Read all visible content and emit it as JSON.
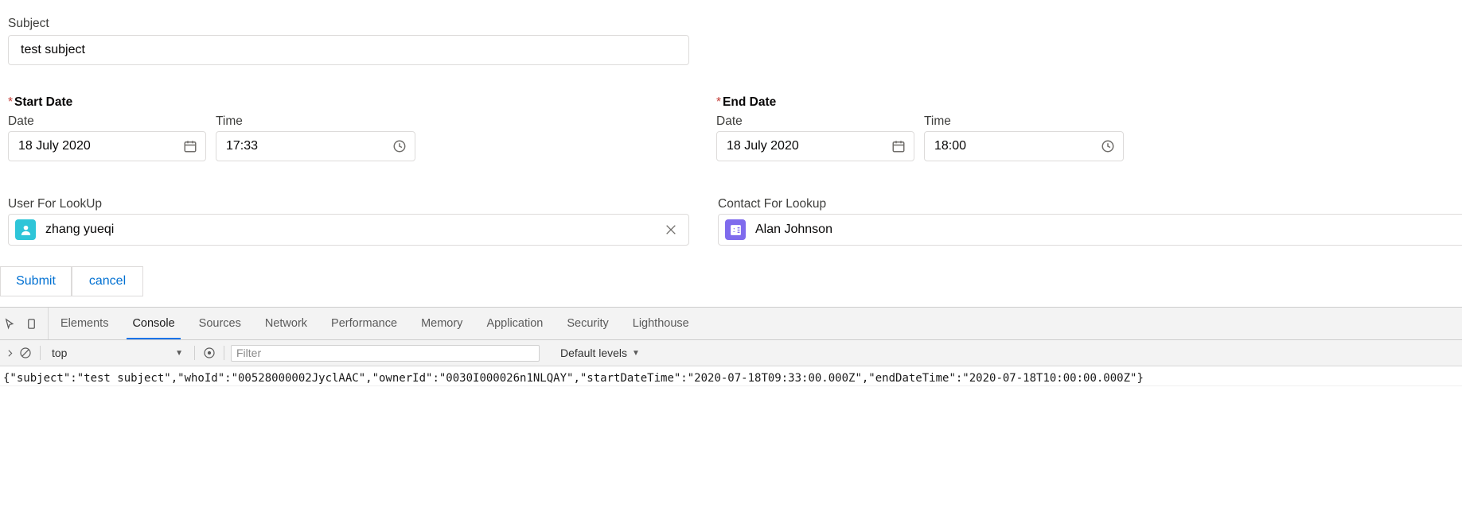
{
  "form": {
    "subject": {
      "label": "Subject",
      "value": "test subject"
    },
    "start": {
      "group_label": "Start Date",
      "required_marker": "*",
      "date_label": "Date",
      "date_value": "18 July 2020",
      "time_label": "Time",
      "time_value": "17:33"
    },
    "end": {
      "group_label": "End Date",
      "required_marker": "*",
      "date_label": "Date",
      "date_value": "18 July 2020",
      "time_label": "Time",
      "time_value": "18:00"
    },
    "user_lookup": {
      "label": "User For LookUp",
      "value": "zhang yueqi",
      "avatar_color": "#2ec5d8"
    },
    "contact_lookup": {
      "label": "Contact For Lookup",
      "value": "Alan Johnson",
      "avatar_color": "#7f6bed"
    },
    "buttons": {
      "submit": "Submit",
      "cancel": "cancel"
    }
  },
  "devtools": {
    "tabs": [
      {
        "label": "Elements",
        "active": false
      },
      {
        "label": "Console",
        "active": true
      },
      {
        "label": "Sources",
        "active": false
      },
      {
        "label": "Network",
        "active": false
      },
      {
        "label": "Performance",
        "active": false
      },
      {
        "label": "Memory",
        "active": false
      },
      {
        "label": "Application",
        "active": false
      },
      {
        "label": "Security",
        "active": false
      },
      {
        "label": "Lighthouse",
        "active": false
      }
    ],
    "toolbar": {
      "context": "top",
      "filter_placeholder": "Filter",
      "levels": "Default levels",
      "caret": "▼"
    },
    "console_output": "{\"subject\":\"test subject\",\"whoId\":\"00528000002JyclAAC\",\"ownerId\":\"0030I000026n1NLQAY\",\"startDateTime\":\"2020-07-18T09:33:00.000Z\",\"endDateTime\":\"2020-07-18T10:00:00.000Z\"}",
    "accent_color": "#1a73e8"
  }
}
